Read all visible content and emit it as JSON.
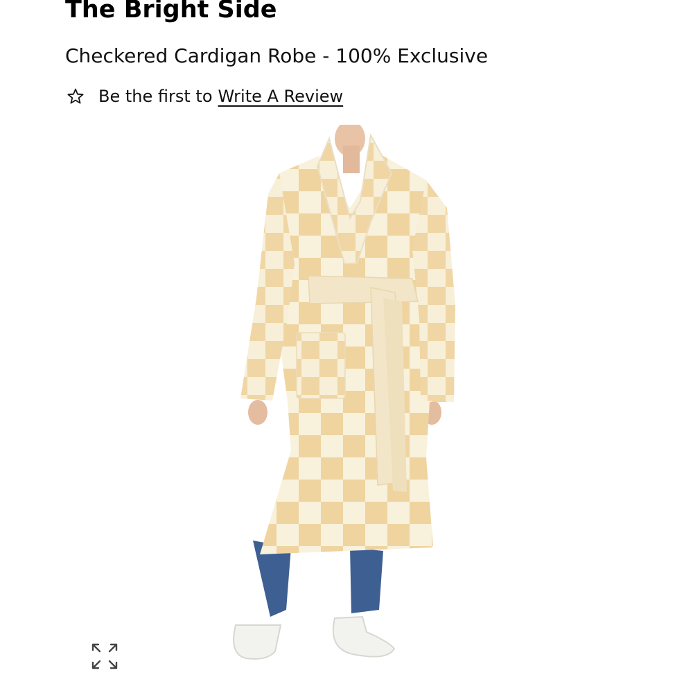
{
  "product": {
    "brand": "The Bright Side",
    "title": "Checkered Cardigan Robe - 100% Exclusive",
    "review_prompt": "Be the first to",
    "review_link": "Write A Review"
  },
  "icons": {
    "review_star": "star-outline-icon",
    "expand": "expand-arrows-icon"
  },
  "colors": {
    "robe_cream": "#f7efd7",
    "robe_tan": "#f0d6a4",
    "jeans": "#3e5f92",
    "text": "#111111"
  }
}
